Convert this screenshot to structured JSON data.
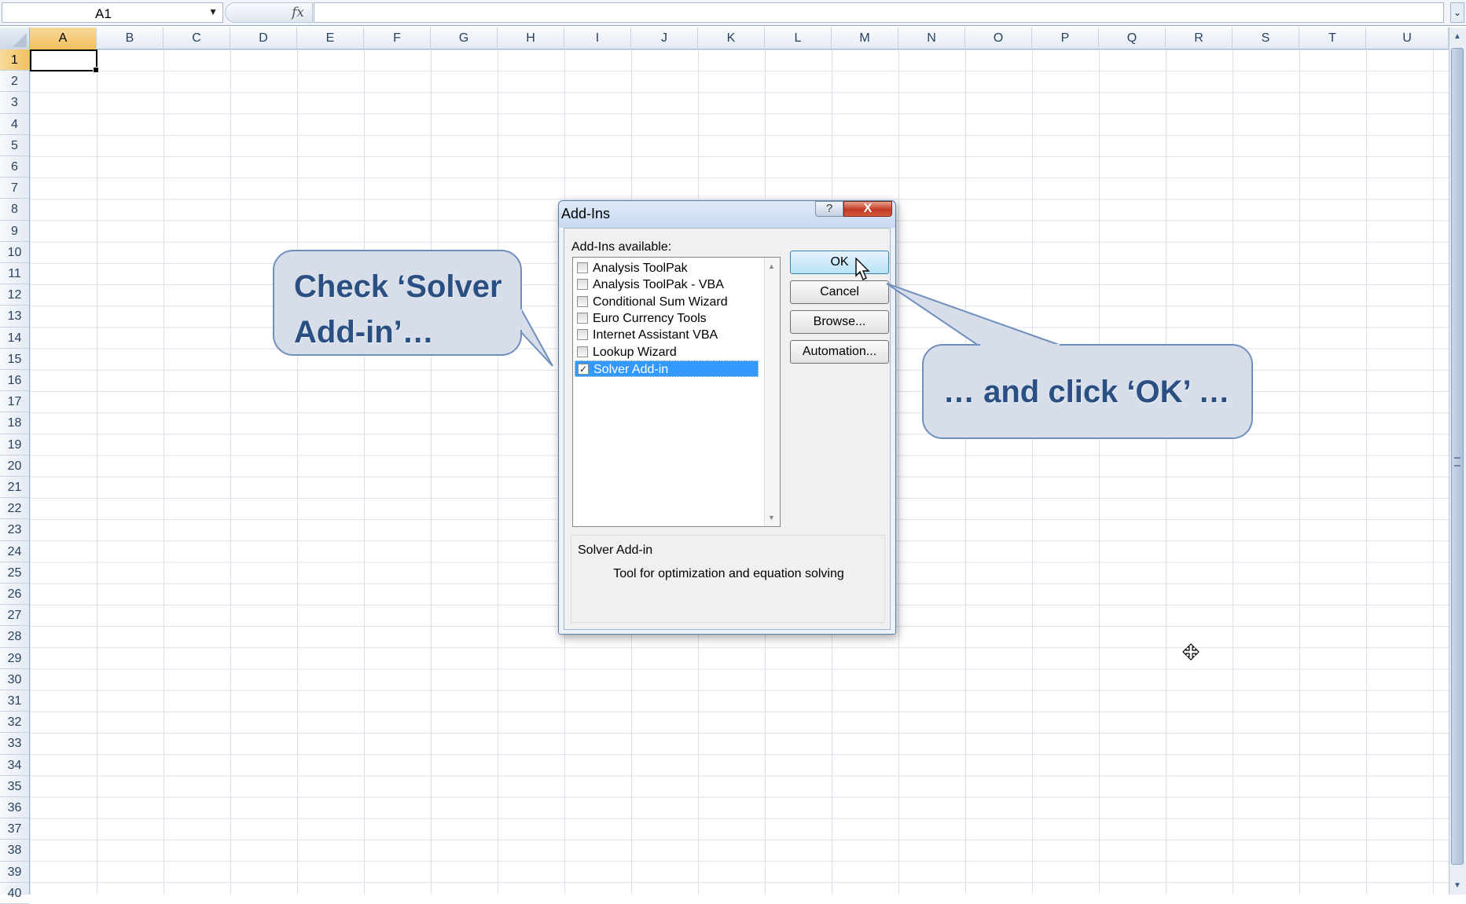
{
  "formula_bar": {
    "name_box_value": "A1",
    "fx_label": "fx",
    "formula_value": ""
  },
  "columns": [
    "A",
    "B",
    "C",
    "D",
    "E",
    "F",
    "G",
    "H",
    "I",
    "J",
    "K",
    "L",
    "M",
    "N",
    "O",
    "P",
    "Q",
    "R",
    "S",
    "T",
    "U"
  ],
  "rows": [
    "1",
    "2",
    "3",
    "4",
    "5",
    "6",
    "7",
    "8",
    "9",
    "10",
    "11",
    "12",
    "13",
    "14",
    "15",
    "16",
    "17",
    "18",
    "19",
    "20",
    "21",
    "22",
    "23",
    "24",
    "25",
    "26",
    "27",
    "28",
    "29",
    "30",
    "31",
    "32",
    "33",
    "34",
    "35",
    "36",
    "37",
    "38",
    "39",
    "40"
  ],
  "active_cell": {
    "column": "A",
    "row": "1"
  },
  "dialog": {
    "title": "Add-Ins",
    "help_label": "?",
    "close_label": "X",
    "available_label": "Add-Ins available:",
    "items": [
      {
        "label": "Analysis ToolPak",
        "checked": false,
        "selected": false
      },
      {
        "label": "Analysis ToolPak - VBA",
        "checked": false,
        "selected": false
      },
      {
        "label": "Conditional Sum Wizard",
        "checked": false,
        "selected": false
      },
      {
        "label": "Euro Currency Tools",
        "checked": false,
        "selected": false
      },
      {
        "label": "Internet Assistant VBA",
        "checked": false,
        "selected": false
      },
      {
        "label": "Lookup Wizard",
        "checked": false,
        "selected": false
      },
      {
        "label": "Solver Add-in",
        "checked": true,
        "selected": true
      }
    ],
    "buttons": {
      "ok": "OK",
      "cancel": "Cancel",
      "browse": "Browse...",
      "automation": "Automation..."
    },
    "description_title": "Solver Add-in",
    "description_text": "Tool for optimization and equation solving"
  },
  "callouts": {
    "left_line1": "Check ‘Solver",
    "left_line2": "Add-in’…",
    "right": "… and click ‘OK’ …"
  },
  "colors": {
    "callout_fill": "#d7deea",
    "callout_border": "#6f90bd",
    "callout_text": "#2a4f82",
    "selection_blue": "#3399ff",
    "header_active": "#f1c15f"
  }
}
